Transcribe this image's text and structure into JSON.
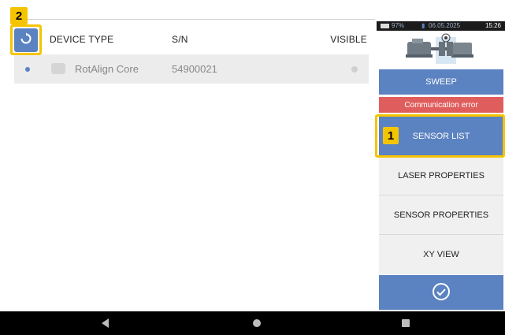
{
  "callouts": {
    "one": "1",
    "two": "2"
  },
  "table": {
    "headers": {
      "device_type": "DEVICE TYPE",
      "serial": "S/N",
      "visible": "VISIBLE"
    },
    "rows": [
      {
        "device_type": "RotAlign Core",
        "serial": "54900021"
      }
    ]
  },
  "status_bar": {
    "battery": "97%",
    "date": "06.05.2025",
    "time": "15:26"
  },
  "menu": {
    "sweep": "SWEEP",
    "error": "Communication error",
    "sensor_list": "SENSOR LIST",
    "laser_properties": "LASER PROPERTIES",
    "sensor_properties": "SENSOR PROPERTIES",
    "xy_view": "XY VIEW"
  },
  "icons": {
    "refresh": "refresh-icon",
    "confirm": "checkmark-circle-icon",
    "back": "back-triangle-icon",
    "home": "home-circle-icon",
    "recent": "recent-square-icon"
  },
  "colors": {
    "accent": "#5b82c1",
    "error": "#e05d5d",
    "callout": "#f5c400",
    "menu_light": "#f0f0f0"
  }
}
